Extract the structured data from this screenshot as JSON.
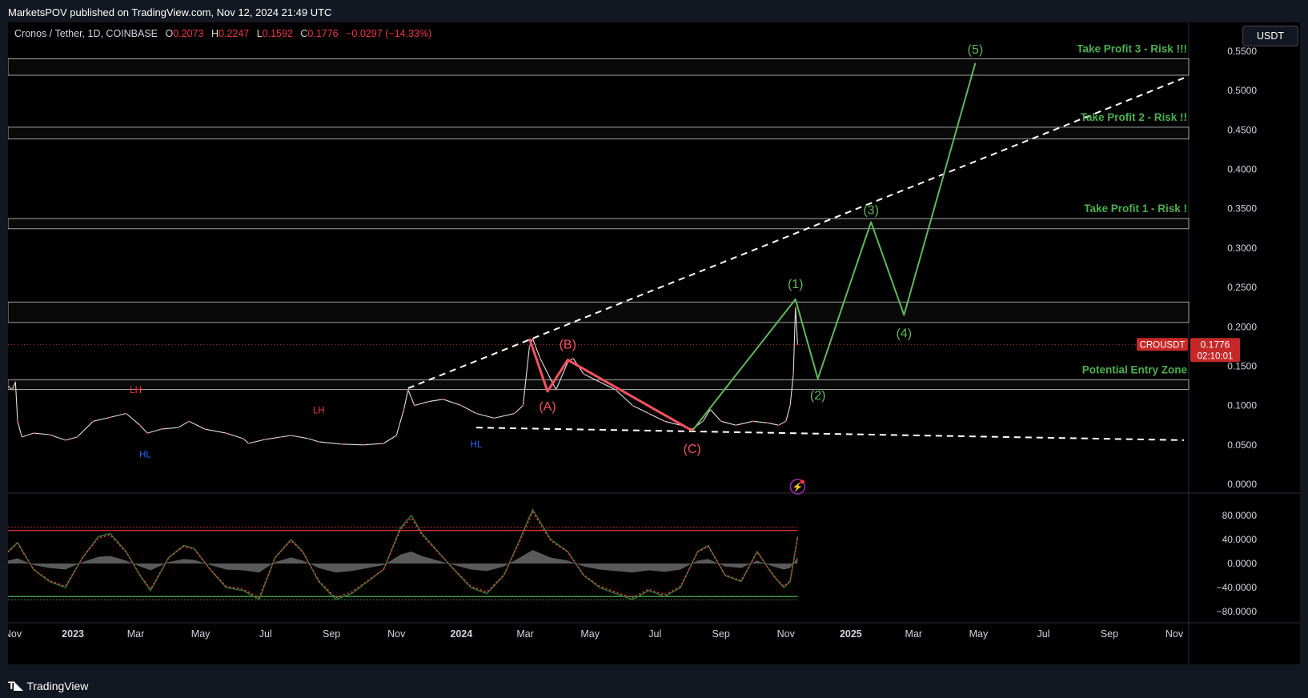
{
  "header": {
    "published": "MarketsPOV published on TradingView.com, Nov 12, 2024 21:49 UTC"
  },
  "symbol": {
    "name": "Cronos / Tether, 1D, COINBASE",
    "open_label": "O",
    "open": "0.2073",
    "high_label": "H",
    "high": "0.2247",
    "low_label": "L",
    "low": "0.1592",
    "close_label": "C",
    "close": "0.1776",
    "change": "−0.0297 (−14.33%)"
  },
  "currency_button": "USDT",
  "footer": {
    "brand": "TradingView"
  },
  "colors": {
    "background": "#000000",
    "frame": "#131722",
    "red": "#f23645",
    "green": "#4caf50",
    "blue": "#2962ff",
    "wave_red": "#f7525f",
    "wave_green": "#5fb85b"
  },
  "chart_data": {
    "type": "line",
    "title": "Cronos / Tether, 1D, COINBASE",
    "price_axis": {
      "ticks": [
        "0.5500",
        "0.5000",
        "0.4500",
        "0.4000",
        "0.3500",
        "0.3000",
        "0.2500",
        "0.2000",
        "0.1500",
        "0.1000",
        "0.0500",
        "0.0000"
      ],
      "range": [
        0,
        0.55
      ]
    },
    "time_axis": {
      "ticks": [
        "Nov",
        "2023",
        "Mar",
        "May",
        "Jul",
        "Sep",
        "Nov",
        "2024",
        "Mar",
        "May",
        "Jul",
        "Sep",
        "Nov",
        "2025",
        "Mar",
        "May",
        "Jul",
        "Sep",
        "Nov"
      ],
      "range": [
        "2022-11-01",
        "2025-11-10"
      ]
    },
    "last_price": {
      "symbol": "CROUSDT",
      "value": "0.1776",
      "countdown": "02:10:01"
    },
    "price_series": [
      [
        "2022-11-01",
        0.125
      ],
      [
        "2022-11-05",
        0.12
      ],
      [
        "2022-11-08",
        0.13
      ],
      [
        "2022-11-10",
        0.08
      ],
      [
        "2022-11-14",
        0.06
      ],
      [
        "2022-11-25",
        0.065
      ],
      [
        "2022-12-10",
        0.063
      ],
      [
        "2022-12-25",
        0.056
      ],
      [
        "2023-01-05",
        0.06
      ],
      [
        "2023-01-20",
        0.08
      ],
      [
        "2023-02-05",
        0.085
      ],
      [
        "2023-02-20",
        0.09
      ],
      [
        "2023-03-05",
        0.075
      ],
      [
        "2023-03-12",
        0.065
      ],
      [
        "2023-03-25",
        0.07
      ],
      [
        "2023-04-10",
        0.072
      ],
      [
        "2023-04-20",
        0.08
      ],
      [
        "2023-05-05",
        0.07
      ],
      [
        "2023-05-25",
        0.065
      ],
      [
        "2023-06-10",
        0.058
      ],
      [
        "2023-06-15",
        0.052
      ],
      [
        "2023-07-01",
        0.057
      ],
      [
        "2023-07-15",
        0.06
      ],
      [
        "2023-07-25",
        0.062
      ],
      [
        "2023-08-10",
        0.058
      ],
      [
        "2023-08-20",
        0.054
      ],
      [
        "2023-09-10",
        0.051
      ],
      [
        "2023-10-01",
        0.05
      ],
      [
        "2023-10-20",
        0.052
      ],
      [
        "2023-11-01",
        0.062
      ],
      [
        "2023-11-08",
        0.095
      ],
      [
        "2023-11-12",
        0.12
      ],
      [
        "2023-11-18",
        0.1
      ],
      [
        "2023-12-01",
        0.105
      ],
      [
        "2023-12-15",
        0.108
      ],
      [
        "2024-01-01",
        0.1
      ],
      [
        "2024-01-15",
        0.09
      ],
      [
        "2024-02-01",
        0.084
      ],
      [
        "2024-02-20",
        0.09
      ],
      [
        "2024-02-28",
        0.1
      ],
      [
        "2024-03-05",
        0.175
      ],
      [
        "2024-03-08",
        0.185
      ],
      [
        "2024-03-15",
        0.16
      ],
      [
        "2024-03-30",
        0.12
      ],
      [
        "2024-04-10",
        0.155
      ],
      [
        "2024-04-15",
        0.16
      ],
      [
        "2024-04-25",
        0.14
      ],
      [
        "2024-05-10",
        0.13
      ],
      [
        "2024-05-25",
        0.12
      ],
      [
        "2024-06-10",
        0.1
      ],
      [
        "2024-06-25",
        0.09
      ],
      [
        "2024-07-10",
        0.08
      ],
      [
        "2024-07-25",
        0.075
      ],
      [
        "2024-08-05",
        0.07
      ],
      [
        "2024-08-15",
        0.08
      ],
      [
        "2024-08-22",
        0.095
      ],
      [
        "2024-09-01",
        0.08
      ],
      [
        "2024-09-15",
        0.075
      ],
      [
        "2024-10-01",
        0.08
      ],
      [
        "2024-10-15",
        0.078
      ],
      [
        "2024-10-25",
        0.075
      ],
      [
        "2024-11-01",
        0.08
      ],
      [
        "2024-11-05",
        0.1
      ],
      [
        "2024-11-08",
        0.14
      ],
      [
        "2024-11-10",
        0.2247
      ],
      [
        "2024-11-12",
        0.1776
      ]
    ],
    "horizontal_zones": [
      {
        "label": "Take Profit 3 - Risk !!!",
        "from": 0.5195,
        "to": 0.5405
      },
      {
        "label": "Take Profit 2 - Risk !!",
        "from": 0.4385,
        "to": 0.4535
      },
      {
        "label": "Take Profit 1 - Risk !",
        "from": 0.3245,
        "to": 0.3375
      },
      {
        "label": "",
        "from": 0.2055,
        "to": 0.2315
      },
      {
        "label": "Potential Entry Zone",
        "from": 0.1205,
        "to": 0.1325
      }
    ],
    "trendlines": [
      {
        "name": "upper",
        "points": [
          [
            "2023-11-12",
            0.122
          ],
          [
            "2025-11-10",
            0.516
          ]
        ]
      },
      {
        "name": "lower",
        "points": [
          [
            "2024-01-15",
            0.072
          ],
          [
            "2025-11-10",
            0.056
          ]
        ]
      }
    ],
    "correction_wave": {
      "labels": [
        "(A)",
        "(B)",
        "(C)"
      ],
      "points": [
        [
          "2024-03-05",
          0.185
        ],
        [
          "2024-03-22",
          0.118
        ],
        [
          "2024-04-10",
          0.158
        ],
        [
          "2024-08-05",
          0.068
        ]
      ]
    },
    "impulse_wave": {
      "labels": [
        "(1)",
        "(2)",
        "(3)",
        "(4)",
        "(5)"
      ],
      "points": [
        [
          "2024-08-05",
          0.068
        ],
        [
          "2024-11-10",
          0.235
        ],
        [
          "2024-12-01",
          0.134
        ],
        [
          "2025-01-20",
          0.333
        ],
        [
          "2025-02-20",
          0.215
        ],
        [
          "2025-04-28",
          0.535
        ]
      ]
    },
    "swing_labels": [
      {
        "text": "LH",
        "date": "2023-03-01",
        "price": 0.116,
        "color": "#f23645"
      },
      {
        "text": "HL",
        "date": "2023-03-10",
        "price": 0.034,
        "color": "#2962ff"
      },
      {
        "text": "LH",
        "date": "2023-08-20",
        "price": 0.09,
        "color": "#f23645"
      },
      {
        "text": "HL",
        "date": "2024-01-15",
        "price": 0.047,
        "color": "#2962ff"
      }
    ],
    "oscillator": {
      "ticks": [
        "80.0000",
        "40.0000",
        "0.0000",
        "−40.0000",
        "−80.0000"
      ],
      "range": [
        -90,
        100
      ],
      "upper_band": 55,
      "lower_band": -55,
      "series": [
        [
          "2022-11-01",
          20
        ],
        [
          "2022-11-10",
          35
        ],
        [
          "2022-11-25",
          -10
        ],
        [
          "2022-12-10",
          -30
        ],
        [
          "2022-12-25",
          -40
        ],
        [
          "2023-01-10",
          10
        ],
        [
          "2023-01-25",
          45
        ],
        [
          "2023-02-05",
          50
        ],
        [
          "2023-02-20",
          20
        ],
        [
          "2023-03-05",
          -20
        ],
        [
          "2023-03-15",
          -45
        ],
        [
          "2023-04-01",
          10
        ],
        [
          "2023-04-15",
          30
        ],
        [
          "2023-04-25",
          25
        ],
        [
          "2023-05-10",
          -10
        ],
        [
          "2023-05-25",
          -40
        ],
        [
          "2023-06-10",
          -45
        ],
        [
          "2023-06-25",
          -60
        ],
        [
          "2023-07-10",
          10
        ],
        [
          "2023-07-25",
          40
        ],
        [
          "2023-08-05",
          20
        ],
        [
          "2023-08-20",
          -30
        ],
        [
          "2023-09-05",
          -60
        ],
        [
          "2023-09-20",
          -50
        ],
        [
          "2023-10-05",
          -30
        ],
        [
          "2023-10-20",
          -10
        ],
        [
          "2023-11-05",
          60
        ],
        [
          "2023-11-15",
          80
        ],
        [
          "2023-11-25",
          50
        ],
        [
          "2023-12-10",
          20
        ],
        [
          "2023-12-25",
          -10
        ],
        [
          "2024-01-10",
          -40
        ],
        [
          "2024-01-25",
          -50
        ],
        [
          "2024-02-10",
          -20
        ],
        [
          "2024-02-25",
          40
        ],
        [
          "2024-03-08",
          90
        ],
        [
          "2024-03-25",
          40
        ],
        [
          "2024-04-10",
          20
        ],
        [
          "2024-04-25",
          -20
        ],
        [
          "2024-05-10",
          -40
        ],
        [
          "2024-05-25",
          -50
        ],
        [
          "2024-06-10",
          -60
        ],
        [
          "2024-06-25",
          -45
        ],
        [
          "2024-07-10",
          -55
        ],
        [
          "2024-07-25",
          -40
        ],
        [
          "2024-08-10",
          20
        ],
        [
          "2024-08-20",
          30
        ],
        [
          "2024-09-05",
          -20
        ],
        [
          "2024-09-20",
          -30
        ],
        [
          "2024-10-05",
          20
        ],
        [
          "2024-10-20",
          -20
        ],
        [
          "2024-10-30",
          -40
        ],
        [
          "2024-11-05",
          -30
        ],
        [
          "2024-11-12",
          45
        ]
      ]
    }
  }
}
